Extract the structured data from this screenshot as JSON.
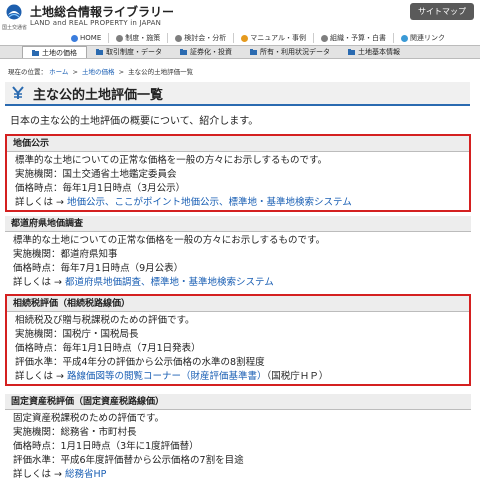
{
  "header": {
    "logo_caption": "国土交通省",
    "title": "土地総合情報ライブラリー",
    "subtitle": "LAND and REAL PROPERTY in JAPAN",
    "sitemap_label": "サイトマップ"
  },
  "topnav": [
    {
      "label": "HOME",
      "icon_color": "#3b7ddd",
      "icon": "home-icon"
    },
    {
      "label": "制度・施策",
      "icon_color": "#7f7f7f",
      "icon": "document-icon"
    },
    {
      "label": "検討会・分析",
      "icon_color": "#7f7f7f",
      "icon": "chart-icon"
    },
    {
      "label": "マニュアル・事例",
      "icon_color": "#e59a1e",
      "icon": "manual-icon"
    },
    {
      "label": "組織・予算・白書",
      "icon_color": "#7f7f7f",
      "icon": "organization-icon"
    },
    {
      "label": "関連リンク",
      "icon_color": "#3b9ad6",
      "icon": "link-icon"
    }
  ],
  "subnav": [
    {
      "label": "土地の価格",
      "active": true
    },
    {
      "label": "取引制度・データ",
      "active": false
    },
    {
      "label": "証券化・投資",
      "active": false
    },
    {
      "label": "所有・利用状況データ",
      "active": false
    },
    {
      "label": "土地基本情報",
      "active": false
    }
  ],
  "breadcrumb": {
    "prefix": "現在の位置：",
    "items": [
      "ホーム",
      "土地の価格",
      "主な公的土地評価一覧"
    ],
    "separator": ">"
  },
  "page": {
    "title": "主な公的土地評価一覧",
    "intro": "日本の主な公的土地評価の概要について、紹介します。"
  },
  "sections": [
    {
      "heading": "地価公示",
      "desc": "標準的な土地についての正常な価格を一般の方々にお示しするものです。",
      "agency": "実施機関：国土交通省土地鑑定委員会",
      "timing": "価格時点：毎年1月1日時点（3月公示）",
      "more_prefix": "詳しくは → ",
      "links": [
        "地価公示、",
        "ここがポイント地価公示、",
        "標準地・基準地検索システム"
      ]
    },
    {
      "heading": "都道府県地価調査",
      "desc": "標準的な土地についての正常な価格を一般の方々にお示しするものです。",
      "agency": "実施機関：都道府県知事",
      "timing": "価格時点：毎年7月1日時点（9月公表）",
      "more_prefix": "詳しくは → ",
      "links": [
        "都道府県地価調査、",
        "標準地・基準地検索システム"
      ]
    },
    {
      "heading": "相続税評価（相続税路線価）",
      "desc": "相続税及び贈与税課税のための評価です。",
      "agency": "実施機関：国税庁・国税局長",
      "timing": "価格時点：毎年1月1日時点（7月1日発表）",
      "level": "評価水準：平成4年分の評価から公示価格の水準の8割程度",
      "more_prefix": "詳しくは → ",
      "links": [
        "路線価図等の閲覧コーナー（財産評価基準書）"
      ],
      "more_suffix": "（国税庁ＨＰ）"
    },
    {
      "heading": "固定資産税評価（固定資産税路線価）",
      "desc": "固定資産税課税のための評価です。",
      "agency": "実施機関：総務省・市町村長",
      "timing": "価格時点：1月1日時点（3年に1度評価替）",
      "level": "評価水準：平成6年度評価替から公示価格の7割を目途",
      "more_prefix": "詳しくは → ",
      "links": [
        "総務省HP"
      ]
    }
  ],
  "colors": {
    "accent": "#2a6ab0",
    "highlight_border": "#d42020",
    "link": "#1a5fb4"
  }
}
